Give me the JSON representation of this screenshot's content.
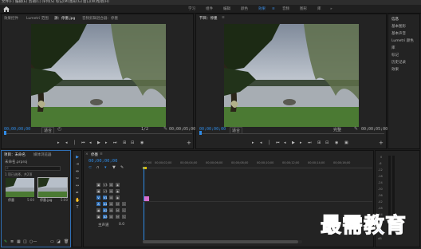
{
  "menu": [
    "文件(F)",
    "编辑(E)",
    "剪辑(C)",
    "序列(S)",
    "标记(M)",
    "图形(G)",
    "窗口(W)",
    "帮助(H)"
  ],
  "workspaces": [
    "学习",
    "组件",
    "编辑",
    "颜色",
    "效果",
    "音频",
    "图形",
    "库"
  ],
  "active_workspace": "效果",
  "source_panel": {
    "tabs": [
      "效果控件",
      "Lumetri 范围",
      "源：停墨.jpg",
      "音频剪辑混合器：停墨"
    ],
    "timecode_left": "00;00;00;00",
    "fit": "适合",
    "fraction": "1/2",
    "timecode_right": "00;00;05;00"
  },
  "program_panel": {
    "tab": "节目：停墨",
    "timecode_left": "00;00;00;00",
    "fit": "适合",
    "fraction": "完整",
    "timecode_right": "00;00;05;00"
  },
  "right_panel": {
    "title": "信息",
    "items": [
      "基本图形",
      "基本声音",
      "Lumetri 颜色",
      "库",
      "标记",
      "历史记录",
      "效果"
    ]
  },
  "project_panel": {
    "tabs": [
      "项目：未命名",
      "媒体浏览器"
    ],
    "file": "未命名.prproj",
    "search_placeholder": "",
    "items_count": "1 项已选择，共2项",
    "clips": [
      {
        "name": "停墨",
        "duration": "5:00"
      },
      {
        "name": "停墨.jpg",
        "duration": "5:00"
      }
    ]
  },
  "timeline": {
    "tab": "停墨",
    "timecode": "00;00;00;00",
    "ruler": [
      ":00:00",
      "00;00;02;00",
      "00;00;04;00",
      "00;00;06;00",
      "00;00;08;00",
      "00;00;10;00",
      "00;00;12;00",
      "00;00;14;00",
      "00;00;16;00"
    ],
    "video_tracks": [
      "V3",
      "V2",
      "V1"
    ],
    "audio_tracks": [
      "A1",
      "A2",
      "A3"
    ],
    "master": "主声道",
    "master_value": "0.0"
  },
  "meter_ticks": [
    "0",
    "-6",
    "-12",
    "-18",
    "-24",
    "-30",
    "-36",
    "-42",
    "-48",
    "-54",
    "dB"
  ],
  "watermark": "最需教育",
  "colors": {
    "accent": "#2f8be6",
    "clip": "#d86fd0"
  }
}
